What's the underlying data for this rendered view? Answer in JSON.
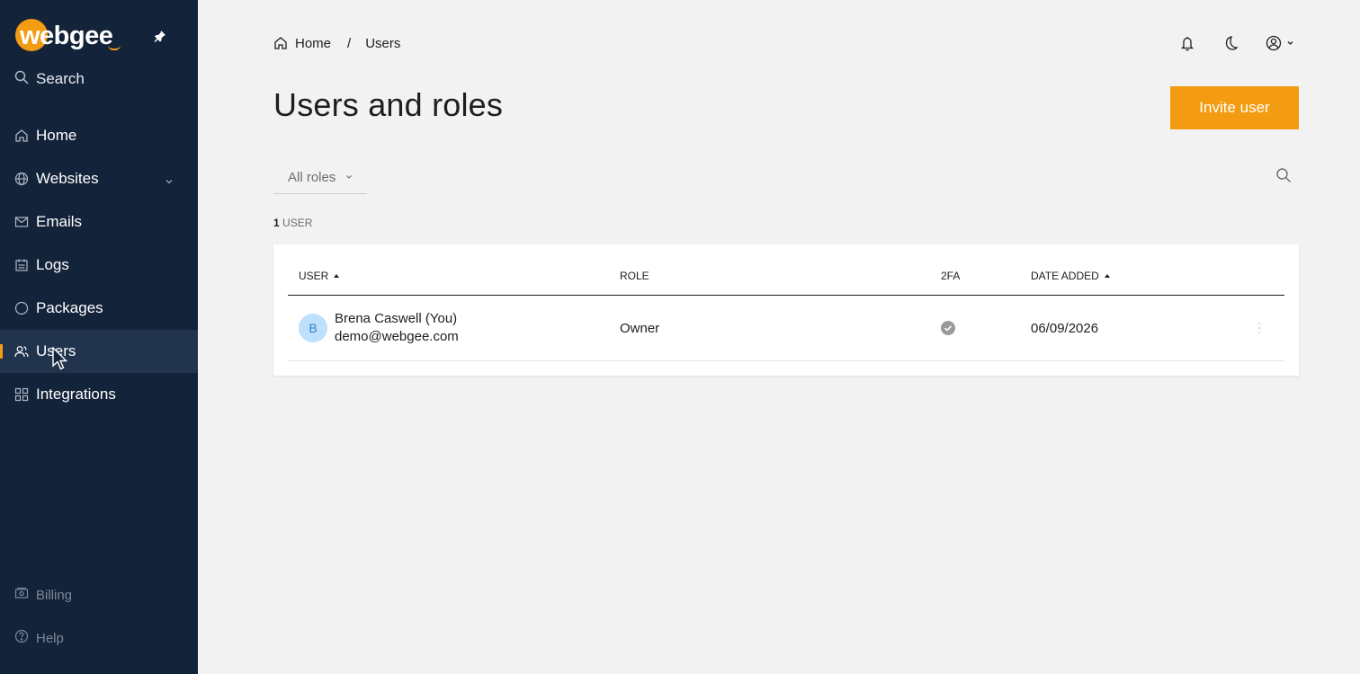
{
  "sidebar": {
    "logo": "webgee",
    "search_label": "Search",
    "items": [
      {
        "label": "Home",
        "icon": "home-icon"
      },
      {
        "label": "Websites",
        "icon": "globe-icon"
      },
      {
        "label": "Emails",
        "icon": "mail-icon"
      },
      {
        "label": "Logs",
        "icon": "logs-icon"
      },
      {
        "label": "Packages",
        "icon": "package-icon"
      },
      {
        "label": "Users",
        "icon": "users-icon",
        "active": true
      },
      {
        "label": "Integrations",
        "icon": "integrations-icon"
      }
    ],
    "bottom": [
      {
        "label": "Billing",
        "icon": "billing-icon"
      },
      {
        "label": "Help",
        "icon": "help-icon"
      }
    ]
  },
  "breadcrumb": {
    "home": "Home",
    "separator": "/",
    "current": "Users"
  },
  "page": {
    "title": "Users and roles",
    "invite_label": "Invite user",
    "role_filter": "All roles",
    "count_number": "1",
    "count_label": "USER"
  },
  "table": {
    "headers": {
      "user": "USER",
      "role": "ROLE",
      "twofa": "2FA",
      "date_added": "DATE ADDED"
    },
    "rows": [
      {
        "avatar": "B",
        "name": "Brena Caswell  (You)",
        "email": "demo@webgee.com",
        "role": "Owner",
        "twofa_enabled": true,
        "date_added": "06/09/2026"
      }
    ]
  },
  "colors": {
    "sidebar_bg": "#13233a",
    "accent": "#f39c12",
    "page_bg": "#f2f2f2"
  }
}
